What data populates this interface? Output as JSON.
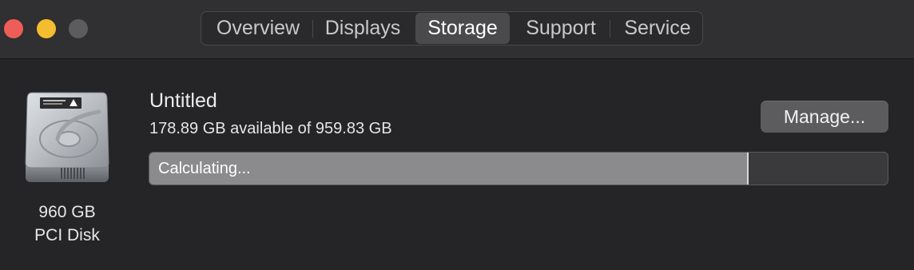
{
  "window": {
    "controls": [
      "close",
      "minimize",
      "zoom"
    ]
  },
  "tabs": [
    {
      "label": "Overview",
      "selected": false
    },
    {
      "label": "Displays",
      "selected": false
    },
    {
      "label": "Storage",
      "selected": true
    },
    {
      "label": "Support",
      "selected": false
    },
    {
      "label": "Service",
      "selected": false
    }
  ],
  "disk": {
    "icon": "hard-drive-icon",
    "size_label": "960 GB",
    "type_label": "PCI Disk"
  },
  "volume": {
    "name": "Untitled",
    "available_text": "178.89 GB available of 959.83 GB",
    "manage_label": "Manage...",
    "status_text": "Calculating...",
    "used_fraction": 0.81
  },
  "colors": {
    "close": "#ee5d57",
    "minimize": "#f4bd2f",
    "zoom_inactive": "#5c5b5e",
    "bar_fill": "#8b8a8c"
  }
}
